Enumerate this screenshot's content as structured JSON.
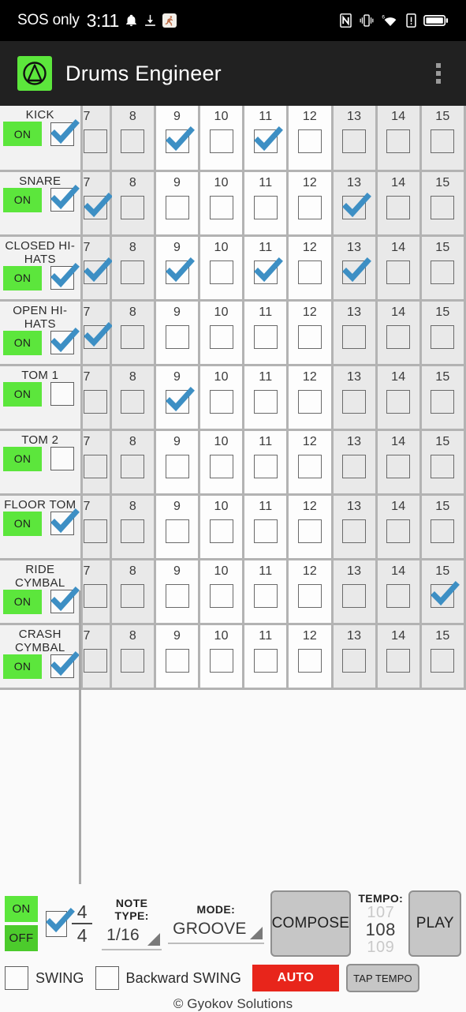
{
  "status_bar": {
    "carrier": "SOS only",
    "time": "3:11",
    "left_icons": [
      "bell-icon",
      "download-icon",
      "running-app-icon"
    ],
    "right_icons": [
      "nfc-icon",
      "vibrate-icon",
      "wifi-6-icon",
      "alert-icon",
      "battery-icon"
    ]
  },
  "app_bar": {
    "title": "Drums Engineer",
    "logo_color": "#5ce63c",
    "overflow_menu": "more-options"
  },
  "grid": {
    "visible_steps": [
      "7",
      "8",
      "9",
      "10",
      "11",
      "12",
      "13",
      "14",
      "15"
    ],
    "step_shading": [
      "gray",
      "gray",
      "white",
      "white",
      "white",
      "white",
      "gray",
      "gray",
      "gray"
    ],
    "on_label": "ON",
    "tracks": [
      {
        "name": "KICK",
        "enabled": true,
        "mute_checked": true,
        "steps": [
          false,
          false,
          true,
          false,
          true,
          false,
          false,
          false,
          false
        ]
      },
      {
        "name": "SNARE",
        "enabled": true,
        "mute_checked": true,
        "steps": [
          true,
          false,
          false,
          false,
          false,
          false,
          true,
          false,
          false
        ]
      },
      {
        "name": "CLOSED HI-HATS",
        "enabled": true,
        "mute_checked": true,
        "steps": [
          true,
          false,
          true,
          false,
          true,
          false,
          true,
          false,
          false
        ]
      },
      {
        "name": "OPEN HI-HATS",
        "enabled": true,
        "mute_checked": true,
        "steps": [
          true,
          false,
          false,
          false,
          false,
          false,
          false,
          false,
          false
        ]
      },
      {
        "name": "TOM 1",
        "enabled": true,
        "mute_checked": false,
        "steps": [
          false,
          false,
          true,
          false,
          false,
          false,
          false,
          false,
          false
        ]
      },
      {
        "name": "TOM 2",
        "enabled": true,
        "mute_checked": false,
        "steps": [
          false,
          false,
          false,
          false,
          false,
          false,
          false,
          false,
          false
        ]
      },
      {
        "name": "FLOOR TOM",
        "enabled": true,
        "mute_checked": true,
        "steps": [
          false,
          false,
          false,
          false,
          false,
          false,
          false,
          false,
          false
        ]
      },
      {
        "name": "RIDE CYMBAL",
        "enabled": true,
        "mute_checked": true,
        "steps": [
          false,
          false,
          false,
          false,
          false,
          false,
          false,
          false,
          true
        ]
      },
      {
        "name": "CRASH CYMBAL",
        "enabled": true,
        "mute_checked": true,
        "steps": [
          false,
          false,
          false,
          false,
          false,
          false,
          false,
          false,
          false
        ]
      }
    ]
  },
  "controls": {
    "metronome_on": "ON",
    "metronome_off": "OFF",
    "loop_checked": true,
    "time_signature": {
      "numerator": "4",
      "denominator": "4"
    },
    "note_type": {
      "label": "NOTE TYPE:",
      "value": "1/16"
    },
    "mode": {
      "label": "MODE:",
      "value": "GROOVE"
    },
    "compose_button": "COMPOSE",
    "play_button": "PLAY",
    "tempo": {
      "label": "TEMPO:",
      "previous": "107",
      "current": "108",
      "next": "109"
    },
    "swing": {
      "label": "SWING",
      "checked": false
    },
    "backward_swing": {
      "label": "Backward SWING",
      "checked": false
    },
    "auto_button": "AUTO",
    "tap_tempo_button": "TAP TEMPO"
  },
  "footer": {
    "copyright": "© Gyokov Solutions"
  },
  "colors": {
    "accent_green": "#5ce63c",
    "auto_red": "#e8251b",
    "check_blue": "#3d8fc4",
    "app_bar": "#212121"
  }
}
